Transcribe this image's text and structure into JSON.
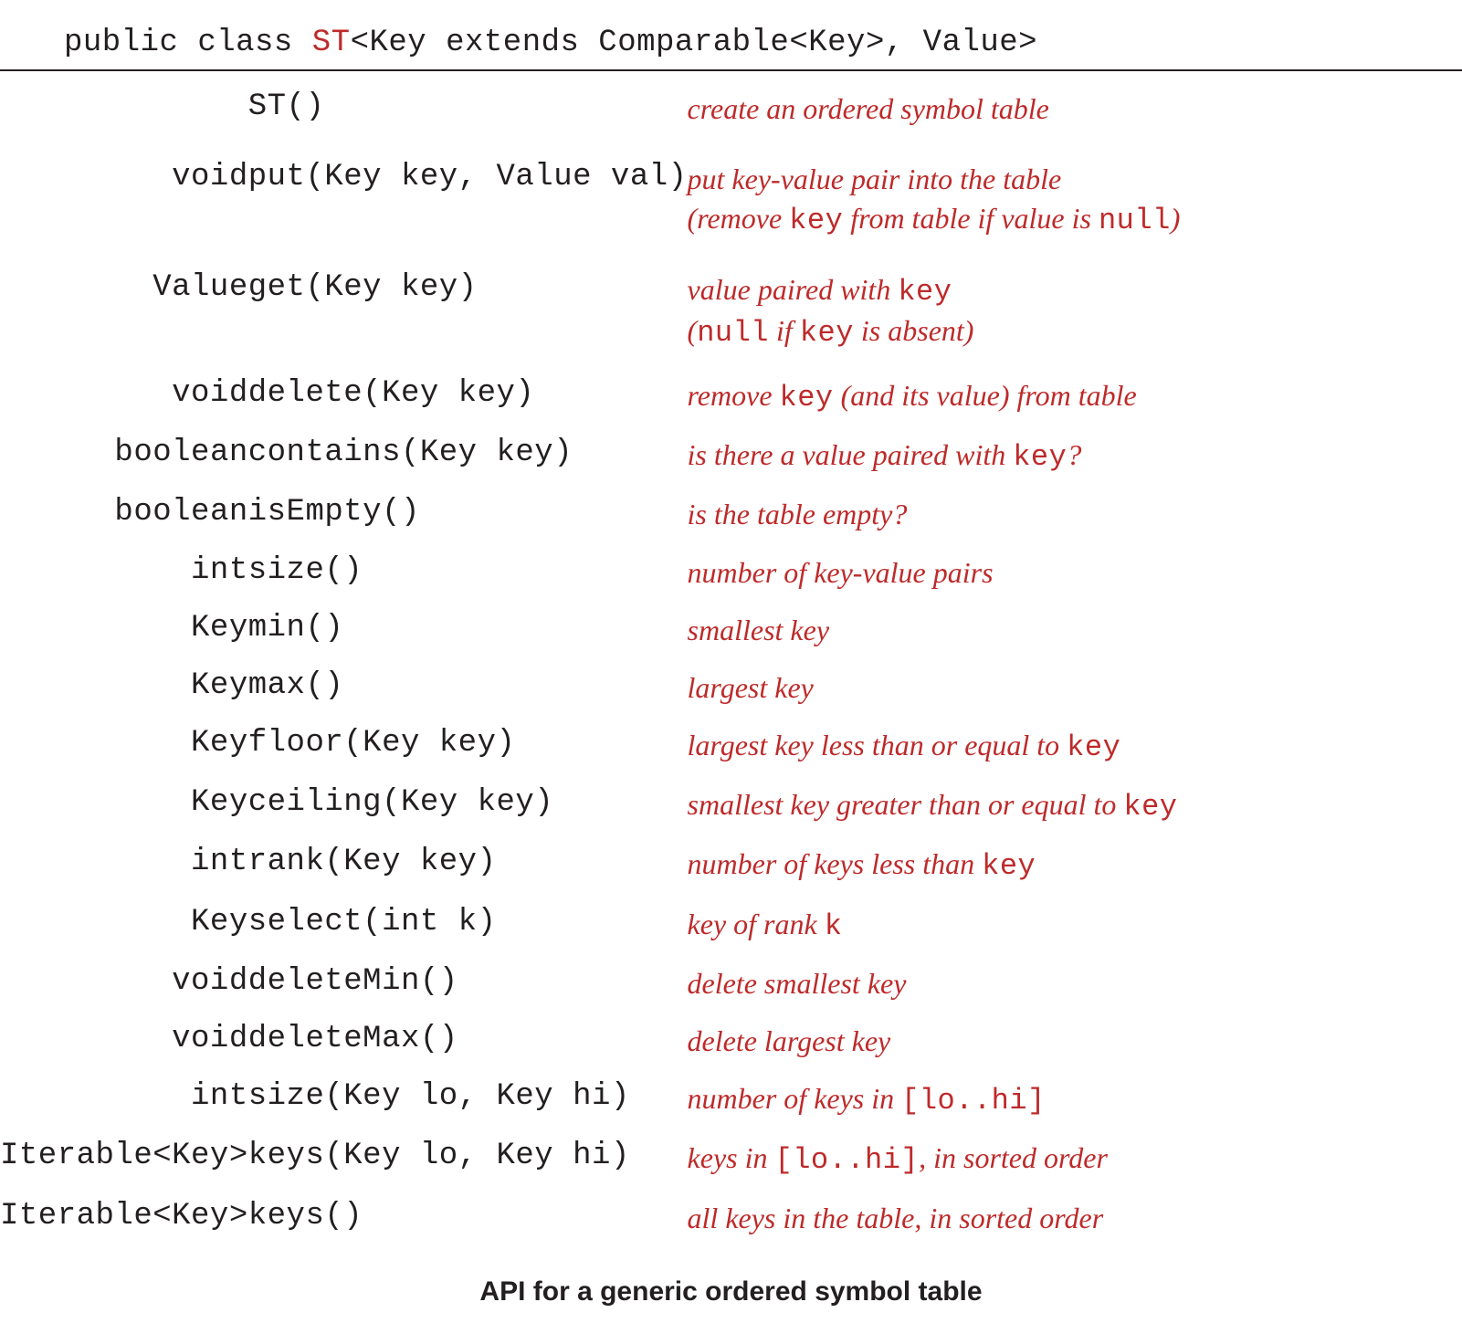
{
  "header": {
    "prefix": "public class ",
    "classname": "ST",
    "generics": "<Key extends Comparable<Key>, Value>"
  },
  "rows": [
    {
      "ret": "",
      "sig": "ST()",
      "desc_segments": [
        {
          "t": "text",
          "v": "create an ordered symbol table"
        }
      ]
    },
    {
      "ret": "void",
      "sig": "put(Key key, Value val)",
      "desc_segments": [
        {
          "t": "text",
          "v": "put key-value pair into the table"
        },
        {
          "t": "br"
        },
        {
          "t": "text",
          "v": "(remove "
        },
        {
          "t": "code",
          "v": "key"
        },
        {
          "t": "text",
          "v": " from table if value is "
        },
        {
          "t": "code",
          "v": "null"
        },
        {
          "t": "text",
          "v": ")"
        }
      ]
    },
    {
      "ret": "Value",
      "sig": "get(Key key)",
      "desc_segments": [
        {
          "t": "text",
          "v": "value paired with "
        },
        {
          "t": "code",
          "v": "key"
        },
        {
          "t": "br"
        },
        {
          "t": "text",
          "v": "("
        },
        {
          "t": "code",
          "v": "null"
        },
        {
          "t": "text",
          "v": " if "
        },
        {
          "t": "code",
          "v": "key"
        },
        {
          "t": "text",
          "v": " is absent)"
        }
      ]
    },
    {
      "ret": "void",
      "sig": "delete(Key key)",
      "desc_segments": [
        {
          "t": "text",
          "v": "remove "
        },
        {
          "t": "code",
          "v": "key"
        },
        {
          "t": "text",
          "v": " (and its value) from table"
        }
      ]
    },
    {
      "ret": "boolean",
      "sig": "contains(Key key)",
      "desc_segments": [
        {
          "t": "text",
          "v": "is there a value paired with "
        },
        {
          "t": "code",
          "v": "key"
        },
        {
          "t": "text",
          "v": "?"
        }
      ]
    },
    {
      "ret": "boolean",
      "sig": "isEmpty()",
      "desc_segments": [
        {
          "t": "text",
          "v": "is the table empty?"
        }
      ]
    },
    {
      "ret": "int",
      "sig": "size()",
      "desc_segments": [
        {
          "t": "text",
          "v": "number of key-value pairs"
        }
      ]
    },
    {
      "ret": "Key",
      "sig": "min()",
      "desc_segments": [
        {
          "t": "text",
          "v": "smallest key"
        }
      ]
    },
    {
      "ret": "Key",
      "sig": "max()",
      "desc_segments": [
        {
          "t": "text",
          "v": "largest key"
        }
      ]
    },
    {
      "ret": "Key",
      "sig": "floor(Key key)",
      "desc_segments": [
        {
          "t": "text",
          "v": "largest key less than or equal to "
        },
        {
          "t": "code",
          "v": "key"
        }
      ]
    },
    {
      "ret": "Key",
      "sig": "ceiling(Key key)",
      "desc_segments": [
        {
          "t": "text",
          "v": "smallest key greater than or equal to "
        },
        {
          "t": "code",
          "v": "key"
        }
      ]
    },
    {
      "ret": "int",
      "sig": "rank(Key key)",
      "desc_segments": [
        {
          "t": "text",
          "v": "number of keys less than "
        },
        {
          "t": "code",
          "v": "key"
        }
      ]
    },
    {
      "ret": "Key",
      "sig": "select(int k)",
      "desc_segments": [
        {
          "t": "text",
          "v": "key of rank "
        },
        {
          "t": "code",
          "v": "k"
        }
      ]
    },
    {
      "ret": "void",
      "sig": "deleteMin()",
      "desc_segments": [
        {
          "t": "text",
          "v": "delete smallest key"
        }
      ]
    },
    {
      "ret": "void",
      "sig": "deleteMax()",
      "desc_segments": [
        {
          "t": "text",
          "v": "delete largest key"
        }
      ]
    },
    {
      "ret": "int",
      "sig": "size(Key lo, Key hi)",
      "desc_segments": [
        {
          "t": "text",
          "v": "number of keys in "
        },
        {
          "t": "code",
          "v": "[lo..hi]"
        }
      ]
    },
    {
      "ret": "Iterable<Key>",
      "sig": "keys(Key lo, Key hi)",
      "desc_segments": [
        {
          "t": "text",
          "v": "keys in "
        },
        {
          "t": "code",
          "v": "[lo..hi]"
        },
        {
          "t": "text",
          "v": ", in sorted order"
        }
      ]
    },
    {
      "ret": "Iterable<Key>",
      "sig": "keys()",
      "desc_segments": [
        {
          "t": "text",
          "v": "all keys in the table, in sorted order"
        }
      ]
    }
  ],
  "caption": "API for a generic ordered symbol table"
}
